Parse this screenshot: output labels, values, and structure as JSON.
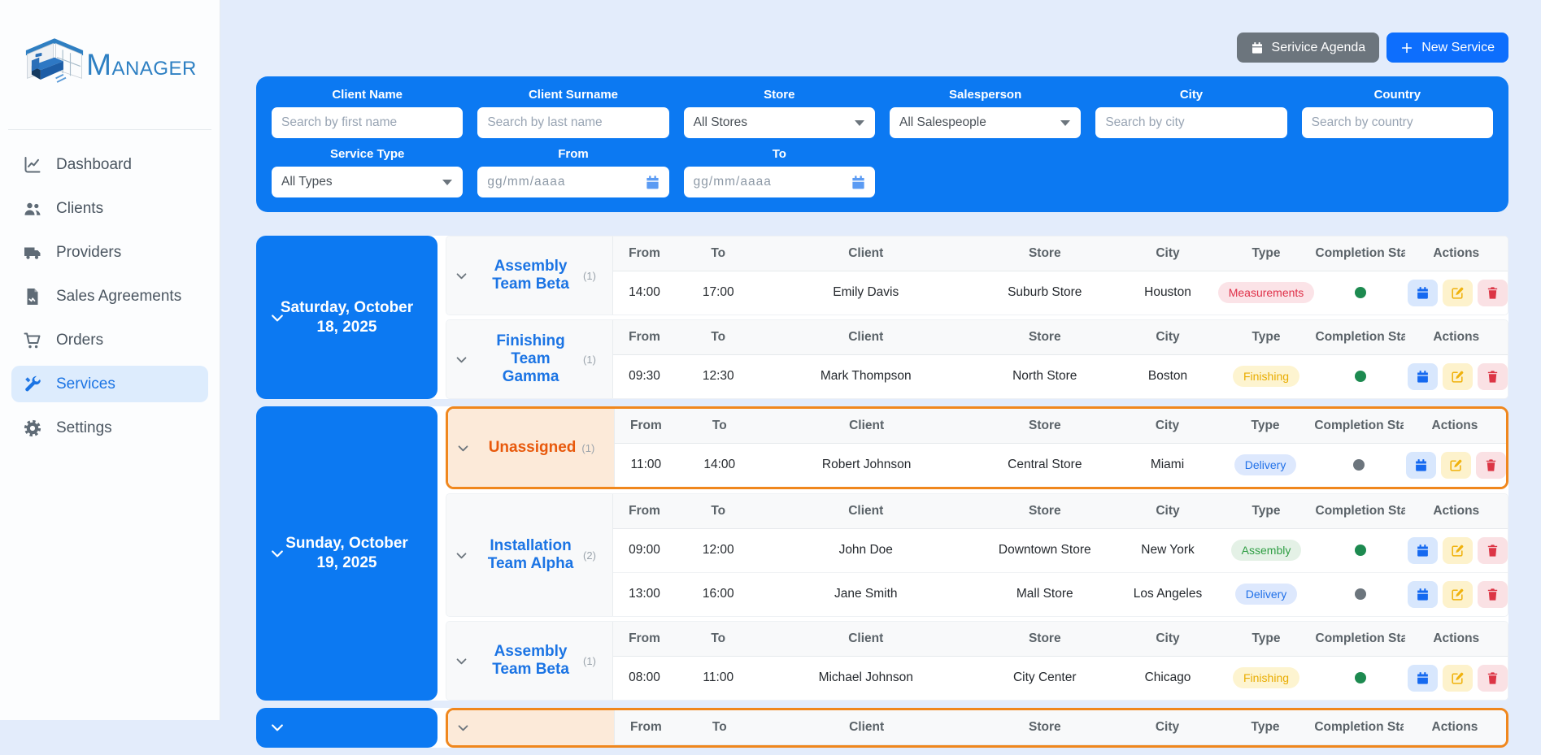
{
  "brand": {
    "first": "M",
    "rest": "ANAGER"
  },
  "sidebar": {
    "items": [
      {
        "label": "Dashboard",
        "icon": "chart-icon",
        "active": false
      },
      {
        "label": "Clients",
        "icon": "users-icon",
        "active": false
      },
      {
        "label": "Providers",
        "icon": "truck-icon",
        "active": false
      },
      {
        "label": "Sales Agreements",
        "icon": "document-icon",
        "active": false
      },
      {
        "label": "Orders",
        "icon": "cart-icon",
        "active": false
      },
      {
        "label": "Services",
        "icon": "tools-icon",
        "active": true
      },
      {
        "label": "Settings",
        "icon": "gear-icon",
        "active": false
      }
    ]
  },
  "header": {
    "agenda_button": "Serivice Agenda",
    "new_service_button": "New Service"
  },
  "filters": {
    "row1": [
      {
        "label": "Client Name",
        "type": "text",
        "placeholder": "Search by first name"
      },
      {
        "label": "Client Surname",
        "type": "text",
        "placeholder": "Search by last name"
      },
      {
        "label": "Store",
        "type": "select",
        "value": "All Stores"
      },
      {
        "label": "Salesperson",
        "type": "select",
        "value": "All Salespeople"
      },
      {
        "label": "City",
        "type": "text",
        "placeholder": "Search by city"
      },
      {
        "label": "Country",
        "type": "text",
        "placeholder": "Search by country"
      }
    ],
    "row2": [
      {
        "label": "Service Type",
        "type": "select",
        "value": "All Types"
      },
      {
        "label": "From",
        "type": "date",
        "placeholder": "gg/mm/aaaa"
      },
      {
        "label": "To",
        "type": "date",
        "placeholder": "gg/mm/aaaa"
      }
    ]
  },
  "table": {
    "columns": [
      "From",
      "To",
      "Client",
      "Store",
      "City",
      "Type",
      "Completion Sta",
      "Actions"
    ]
  },
  "colors": {
    "accent_blue": "#0c79f2",
    "button_blue": "#0d6efd",
    "unassigned_orange": "#f0871d",
    "status_done_green": "#1d8a50",
    "status_pending_gray": "#6c757d"
  },
  "days": [
    {
      "label": "Saturday, October 18, 2025",
      "teams": [
        {
          "name": "Assembly Team Beta",
          "count": "(1)",
          "unassigned": false,
          "rows": [
            {
              "from": "14:00",
              "to": "17:00",
              "client": "Emily Davis",
              "store": "Suburb Store",
              "city": "Houston",
              "type": "Measurements",
              "badge": "measurements",
              "status": "done"
            }
          ]
        },
        {
          "name": "Finishing Team Gamma",
          "count": "(1)",
          "unassigned": false,
          "rows": [
            {
              "from": "09:30",
              "to": "12:30",
              "client": "Mark Thompson",
              "store": "North Store",
              "city": "Boston",
              "type": "Finishing",
              "badge": "finishing",
              "status": "done"
            }
          ]
        }
      ]
    },
    {
      "label": "Sunday, October 19, 2025",
      "teams": [
        {
          "name": "Unassigned",
          "count": "(1)",
          "unassigned": true,
          "rows": [
            {
              "from": "11:00",
              "to": "14:00",
              "client": "Robert Johnson",
              "store": "Central Store",
              "city": "Miami",
              "type": "Delivery",
              "badge": "delivery",
              "status": "pending"
            }
          ]
        },
        {
          "name": "Installation Team Alpha",
          "count": "(2)",
          "unassigned": false,
          "rows": [
            {
              "from": "09:00",
              "to": "12:00",
              "client": "John Doe",
              "store": "Downtown Store",
              "city": "New York",
              "type": "Assembly",
              "badge": "assembly",
              "status": "done"
            },
            {
              "from": "13:00",
              "to": "16:00",
              "client": "Jane Smith",
              "store": "Mall Store",
              "city": "Los Angeles",
              "type": "Delivery",
              "badge": "delivery",
              "status": "pending"
            }
          ]
        },
        {
          "name": "Assembly Team Beta",
          "count": "(1)",
          "unassigned": false,
          "rows": [
            {
              "from": "08:00",
              "to": "11:00",
              "client": "Michael Johnson",
              "store": "City Center",
              "city": "Chicago",
              "type": "Finishing",
              "badge": "finishing",
              "status": "done"
            }
          ]
        }
      ]
    },
    {
      "label": "",
      "teams": [
        {
          "name": "",
          "count": "",
          "unassigned": true,
          "rows": []
        }
      ]
    }
  ]
}
